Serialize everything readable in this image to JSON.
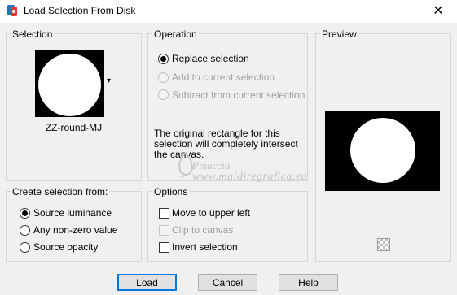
{
  "window": {
    "title": "Load Selection From Disk",
    "close_glyph": "✕",
    "icon": "paint-palette-icon"
  },
  "selection": {
    "label": "Selection",
    "file_name": "ZZ-round-MJ",
    "dropdown_glyph": "▾"
  },
  "operation": {
    "label": "Operation",
    "options": [
      {
        "label": "Replace selection",
        "checked": true,
        "enabled": true
      },
      {
        "label": "Add to current selection",
        "checked": false,
        "enabled": false
      },
      {
        "label": "Subtract from current selection",
        "checked": false,
        "enabled": false
      }
    ],
    "message": "The original rectangle for this selection will completely intersect the canvas."
  },
  "preview": {
    "label": "Preview"
  },
  "create_from": {
    "label": "Create selection from:",
    "options": [
      {
        "label": "Source luminance",
        "checked": true
      },
      {
        "label": "Any non-zero value",
        "checked": false
      },
      {
        "label": "Source opacity",
        "checked": false
      }
    ]
  },
  "options": {
    "label": "Options",
    "items": [
      {
        "label": "Move to upper left",
        "checked": false,
        "enabled": true
      },
      {
        "label": "Clip to canvas",
        "checked": false,
        "enabled": false
      },
      {
        "label": "Invert selection",
        "checked": false,
        "enabled": true
      }
    ]
  },
  "buttons": {
    "load": "Load",
    "cancel": "Cancel",
    "help": "Help"
  },
  "watermark": {
    "name": "Pinuccia",
    "site": "www.maidiregrafica.eu"
  },
  "colors": {
    "background": "#f0f0f0",
    "accent": "#0078d7",
    "preview_bg": "#000000"
  }
}
